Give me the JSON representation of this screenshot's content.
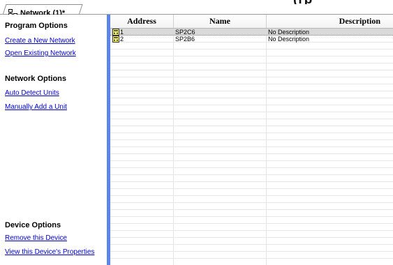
{
  "window": {
    "cutoff_title": "(rp"
  },
  "tab": {
    "label": "Network (1)*",
    "icon": "network-icon"
  },
  "left_panel": {
    "program_options": {
      "title": "Program Options",
      "links": [
        "Create a New Network",
        "Open Existing Network"
      ]
    },
    "network_options": {
      "title": "Network Options",
      "links": [
        "Auto Detect Units",
        "Manually Add a Unit"
      ]
    },
    "device_options": {
      "title": "Device Options",
      "links": [
        "Remove this Device",
        "View this Device's Properties"
      ]
    }
  },
  "table": {
    "columns": [
      "Address",
      "Name",
      "Description"
    ],
    "rows": [
      {
        "address": "1",
        "name": "SP2C6",
        "description": "No Description",
        "selected": true,
        "icon": "device-icon"
      },
      {
        "address": "2",
        "name": "SP2B6",
        "description": "No Description",
        "selected": false,
        "icon": "device-icon"
      }
    ]
  },
  "colors": {
    "splitter": "#5b86e8",
    "link": "#0000cc",
    "selected_row": "#d9d9d9"
  }
}
